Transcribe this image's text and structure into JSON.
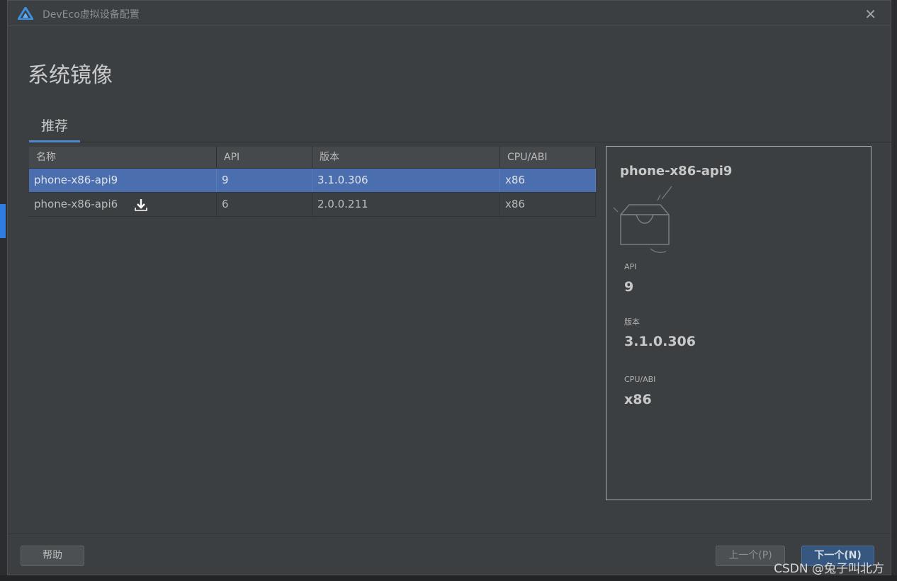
{
  "window": {
    "title": "DevEco虚拟设备配置"
  },
  "page": {
    "title": "系统镜像"
  },
  "tabs": [
    {
      "label": "推荐"
    }
  ],
  "table": {
    "columns": [
      "名称",
      "API",
      "版本",
      "CPU/ABI"
    ],
    "rows": [
      {
        "name": "phone-x86-api9",
        "api": "9",
        "version": "3.1.0.306",
        "abi": "x86",
        "selected": true
      },
      {
        "name": "phone-x86-api6",
        "api": "6",
        "version": "2.0.0.211",
        "abi": "x86",
        "selected": false
      }
    ]
  },
  "detail": {
    "name": "phone-x86-api9",
    "api_label": "API",
    "api_value": "9",
    "version_label": "版本",
    "version_value": "3.1.0.306",
    "abi_label": "CPU/ABI",
    "abi_value": "x86"
  },
  "footer": {
    "help_label": "帮助",
    "prev_label": "上一个(P)",
    "next_label": "下一个(N)"
  },
  "watermark": "CSDN @兔子叫北方",
  "colors": {
    "selected_row": "#4b6eaf",
    "accent": "#4a88c7",
    "primary_button": "#365880"
  }
}
